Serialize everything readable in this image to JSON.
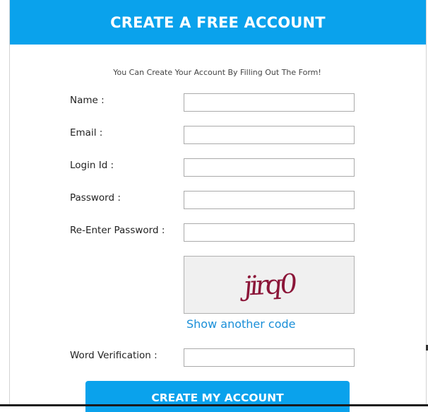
{
  "header": {
    "title": "CREATE A FREE ACCOUNT"
  },
  "form": {
    "subtitle": "You Can Create Your Account By Filling Out The Form!",
    "fields": [
      {
        "label": "Name :",
        "value": "",
        "placeholder": ""
      },
      {
        "label": "Email :",
        "value": "",
        "placeholder": ""
      },
      {
        "label": "Login Id :",
        "value": "",
        "placeholder": ""
      },
      {
        "label": "Password :",
        "value": "",
        "placeholder": ""
      },
      {
        "label": "Re-Enter Password :",
        "value": "",
        "placeholder": ""
      }
    ],
    "captcha": {
      "code": "jirq0",
      "refresh_label": "Show another code"
    },
    "verification": {
      "label": "Word Verification :",
      "value": ""
    },
    "submit_label": "CREATE MY ACCOUNT"
  },
  "colors": {
    "accent": "#0aa2ec",
    "captcha_text": "#8b1538",
    "link": "#1a8fd8"
  }
}
